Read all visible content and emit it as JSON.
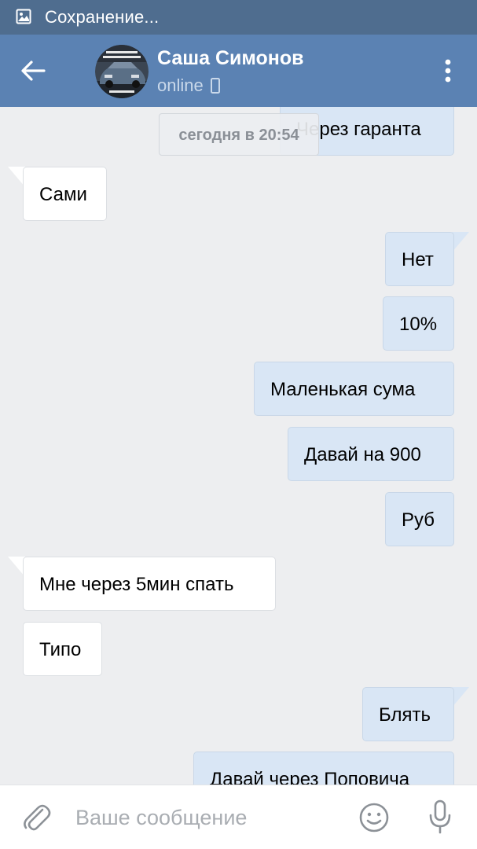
{
  "status_bar": {
    "text": "Сохранение...",
    "icon": "image-save-icon"
  },
  "header": {
    "back_icon": "arrow-left-icon",
    "contact_name": "Саша Симонов",
    "status": "online",
    "status_device_icon": "mobile-phone-icon",
    "menu_icon": "more-vertical-icon",
    "colors": {
      "header": "#5b82b3",
      "status_bar": "#4f6d8f"
    }
  },
  "chat": {
    "date_label": "сегодня в 20:54",
    "messages": [
      {
        "direction": "out",
        "text": "Через гаранта"
      },
      {
        "direction": "in",
        "text": "Сами"
      },
      {
        "direction": "out",
        "text": "Нет"
      },
      {
        "direction": "out",
        "text": "10%"
      },
      {
        "direction": "out",
        "text": "Маленькая сума"
      },
      {
        "direction": "out",
        "text": "Давай на 900"
      },
      {
        "direction": "out",
        "text": "Руб"
      },
      {
        "direction": "in",
        "text": "Мне через 5мин спать"
      },
      {
        "direction": "in",
        "text": "Типо"
      },
      {
        "direction": "out",
        "text": "Блять"
      },
      {
        "direction": "out",
        "text": "Давай через Поповича"
      }
    ],
    "colors": {
      "incoming_bubble": "#ffffff",
      "outgoing_bubble": "#d9e6f5",
      "background": "#edeef0"
    }
  },
  "composer": {
    "placeholder": "Ваше сообщение",
    "attach_icon": "paperclip-icon",
    "emoji_icon": "smiley-icon",
    "mic_icon": "microphone-icon"
  }
}
